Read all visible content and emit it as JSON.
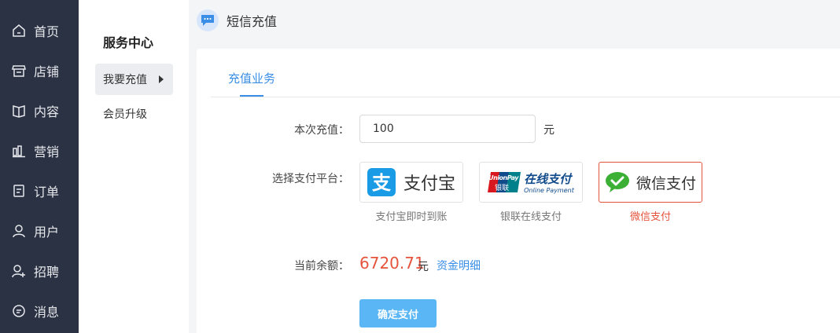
{
  "nav": {
    "items": [
      {
        "label": "首页",
        "icon": "home-icon"
      },
      {
        "label": "店铺",
        "icon": "store-icon"
      },
      {
        "label": "内容",
        "icon": "book-icon"
      },
      {
        "label": "营销",
        "icon": "bar-chart-icon"
      },
      {
        "label": "订单",
        "icon": "order-icon"
      },
      {
        "label": "用户",
        "icon": "user-icon"
      },
      {
        "label": "招聘",
        "icon": "user-add-icon"
      },
      {
        "label": "消息",
        "icon": "message-icon"
      }
    ]
  },
  "submenu": {
    "title": "服务中心",
    "items": [
      {
        "label": "我要充值",
        "active": true
      },
      {
        "label": "会员升级",
        "active": false
      }
    ]
  },
  "page": {
    "title": "短信充值",
    "icon": "chat-bubble-icon"
  },
  "tabs": [
    {
      "label": "充值业务",
      "active": true
    }
  ],
  "form": {
    "amount_label": "本次充值：",
    "amount_value": "100",
    "amount_unit": "元",
    "platform_label": "选择支付平台：",
    "platforms": [
      {
        "name": "支付宝",
        "caption": "支付宝即时到账",
        "icon": "alipay-logo",
        "selected": false
      },
      {
        "name": "在线支付",
        "logo_small": "UnionPay",
        "logo_cn": "银联",
        "logo_sub": "Online Payment",
        "caption": "银联在线支付",
        "icon": "unionpay-logo",
        "selected": false
      },
      {
        "name": "微信支付",
        "caption": "微信支付",
        "icon": "wechat-pay-logo",
        "selected": true
      }
    ],
    "balance_label": "当前余额：",
    "balance_value": "6720.71",
    "balance_unit": "元",
    "detail_link": "资金明细",
    "confirm_button": "确定支付"
  },
  "colors": {
    "accent": "#3a8ee6",
    "danger": "#e5533c",
    "nav_bg": "#2b3244",
    "button_bg": "#5ab6f4"
  }
}
